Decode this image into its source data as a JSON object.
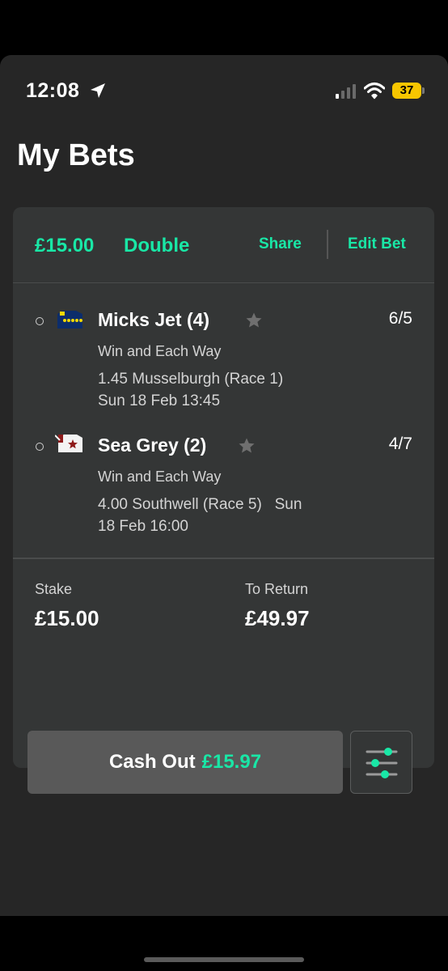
{
  "status_bar": {
    "time": "12:08",
    "battery": "37",
    "icons": [
      "location-arrow-icon",
      "signal-bars-icon",
      "wifi-icon",
      "battery-icon"
    ]
  },
  "page": {
    "title": "My Bets"
  },
  "bet": {
    "amount": "£15.00",
    "type": "Double",
    "share_label": "Share",
    "edit_label": "Edit Bet",
    "selections": [
      {
        "runner": "Micks Jet (4)",
        "odds": "6/5",
        "market": "Win and Each Way",
        "race_line1": "1.45 Musselburgh (Race 1)",
        "race_line2": "Sun 18 Feb 13:45"
      },
      {
        "runner": "Sea Grey (2)",
        "odds": "4/7",
        "market": "Win and Each Way",
        "race_line1": "4.00 Southwell (Race 5)   Sun",
        "race_line2": "18 Feb 16:00"
      }
    ],
    "stake_label": "Stake",
    "stake_value": "£15.00",
    "return_label": "To Return",
    "return_value": "£49.97",
    "cashout_label": "Cash Out",
    "cashout_value": "£15.97"
  },
  "colors": {
    "accent": "#19e7a6",
    "background": "#262626",
    "card": "#343636",
    "button": "#595959"
  }
}
